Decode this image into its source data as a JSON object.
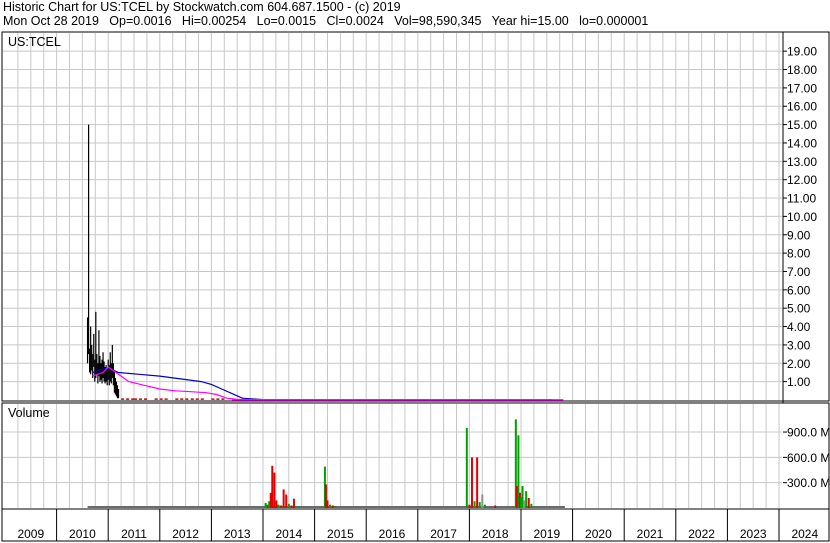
{
  "header": {
    "line1": "Historic Chart for US:TCEL by Stockwatch.com 604.687.1500 - (c) 2019",
    "line2": "Mon Oct 28 2019   Op=0.0016   Hi=0.00254   Lo=0.0015   Cl=0.0024   Vol=98,590,345   Year hi=15.00   lo=0.000001"
  },
  "price_panel": {
    "label": "US:TCEL"
  },
  "volume_panel": {
    "label": "Volume"
  },
  "colors": {
    "grid": "#c8c8c8",
    "price_bar": "#000000",
    "price_down": "#d00000",
    "ma_short": "#ff00ff",
    "ma_long": "#0000c0",
    "vol_up": "#00a000",
    "vol_down": "#e00000",
    "vol_neutral": "#909090"
  },
  "chart_data": [
    {
      "type": "line",
      "panel": "price",
      "title": "US:TCEL",
      "x_axis_labels": [
        "2009",
        "2010",
        "2011",
        "2012",
        "2013",
        "2014",
        "2015",
        "2016",
        "2017",
        "2018",
        "2019",
        "2020",
        "2021",
        "2022",
        "2023",
        "2024"
      ],
      "y_axis_labels": [
        "1.00",
        "2.00",
        "3.00",
        "4.00",
        "5.00",
        "6.00",
        "7.00",
        "8.00",
        "9.00",
        "10.00",
        "11.00",
        "12.00",
        "13.00",
        "14.00",
        "15.00",
        "16.00",
        "17.00",
        "18.00",
        "19.00"
      ],
      "ylim": [
        0,
        19.5
      ],
      "grid": true,
      "series": [
        {
          "style": "high-low bars",
          "x": [
            2010.6,
            2010.62,
            2010.64,
            2010.66,
            2010.68,
            2010.7,
            2010.72,
            2010.74,
            2010.76,
            2010.78,
            2010.8,
            2010.82,
            2010.84,
            2010.86,
            2010.88,
            2010.9,
            2010.92,
            2010.94,
            2010.96,
            2010.98,
            2011.0,
            2011.02,
            2011.04,
            2011.06,
            2011.08,
            2011.1,
            2011.12,
            2011.14,
            2011.16,
            2011.18,
            2011.2
          ],
          "high": [
            4.5,
            15.0,
            2.8,
            4.0,
            3.0,
            2.5,
            3.6,
            2.2,
            4.8,
            2.5,
            2.0,
            3.8,
            2.4,
            2.0,
            2.2,
            2.6,
            2.1,
            1.8,
            1.9,
            1.7,
            2.2,
            1.9,
            2.6,
            2.0,
            3.0,
            2.0,
            1.6,
            1.2,
            1.0,
            0.8,
            0.6
          ],
          "low": [
            2.0,
            2.5,
            1.5,
            1.4,
            1.6,
            1.2,
            1.8,
            1.0,
            1.2,
            1.4,
            0.9,
            1.3,
            1.0,
            1.1,
            0.9,
            1.2,
            1.0,
            0.9,
            1.0,
            0.8,
            1.1,
            0.8,
            1.0,
            0.9,
            1.2,
            0.8,
            0.4,
            0.3,
            0.2,
            0.1,
            0.1
          ]
        },
        {
          "name": "",
          "style": "moving average (short)",
          "x": [
            2010.7,
            2010.9,
            2011.0,
            2011.2,
            2011.4,
            2011.7,
            2012.0,
            2012.3,
            2012.6,
            2012.9,
            2013.1,
            2013.3,
            2013.5,
            2014.0,
            2015.0,
            2016.0,
            2017.0,
            2018.0,
            2019.0,
            2019.6
          ],
          "values": [
            1.3,
            1.5,
            1.8,
            1.4,
            1.0,
            0.8,
            0.6,
            0.5,
            0.45,
            0.4,
            0.3,
            0.1,
            0.03,
            0.01,
            0.01,
            0.01,
            0.01,
            0.01,
            0.01,
            0.01
          ]
        },
        {
          "name": "",
          "style": "moving average (long)",
          "x": [
            2010.7,
            2010.9,
            2011.0,
            2011.2,
            2011.6,
            2012.0,
            2012.4,
            2012.8,
            2013.0,
            2013.2,
            2013.4,
            2013.6,
            2014.0,
            2015.0,
            2016.0,
            2017.0,
            2018.0,
            2019.0,
            2019.6
          ],
          "values": [
            1.5,
            1.7,
            1.75,
            1.5,
            1.4,
            1.3,
            1.15,
            1.0,
            0.85,
            0.6,
            0.35,
            0.1,
            0.02,
            0.01,
            0.01,
            0.01,
            0.01,
            0.01,
            0.01
          ]
        }
      ]
    },
    {
      "type": "bar",
      "panel": "volume",
      "title": "Volume",
      "y_axis_labels": [
        "300.0 M",
        "600.0 M",
        "900.0 M"
      ],
      "ylim": [
        0,
        1050
      ],
      "grid": true,
      "x": [
        2014.05,
        2014.08,
        2014.1,
        2014.12,
        2014.15,
        2014.18,
        2014.22,
        2014.26,
        2014.3,
        2014.35,
        2014.4,
        2014.45,
        2014.5,
        2014.55,
        2014.6,
        2014.7,
        2015.2,
        2015.22,
        2015.25,
        2015.3,
        2015.35,
        2015.4,
        2017.95,
        2018.0,
        2018.05,
        2018.1,
        2018.15,
        2018.2,
        2018.25,
        2018.3,
        2018.5,
        2018.9,
        2018.92,
        2018.95,
        2018.98,
        2019.0,
        2019.03,
        2019.06,
        2019.1,
        2019.15,
        2019.2
      ],
      "values": [
        60,
        40,
        30,
        80,
        180,
        500,
        420,
        90,
        40,
        30,
        220,
        160,
        50,
        30,
        110,
        20,
        490,
        280,
        90,
        40,
        30,
        20,
        950,
        40,
        600,
        80,
        600,
        70,
        160,
        40,
        30,
        1050,
        260,
        860,
        180,
        130,
        260,
        90,
        200,
        120,
        50
      ],
      "direction": [
        "up",
        "up",
        "down",
        "up",
        "down",
        "down",
        "down",
        "down",
        "up",
        "down",
        "down",
        "down",
        "up",
        "down",
        "down",
        "up",
        "up",
        "down",
        "down",
        "up",
        "down",
        "up",
        "up",
        "down",
        "down",
        "up",
        "down",
        "up",
        "neutral",
        "up",
        "down",
        "up",
        "down",
        "up",
        "down",
        "up",
        "up",
        "neutral",
        "up",
        "down",
        "up"
      ]
    }
  ]
}
